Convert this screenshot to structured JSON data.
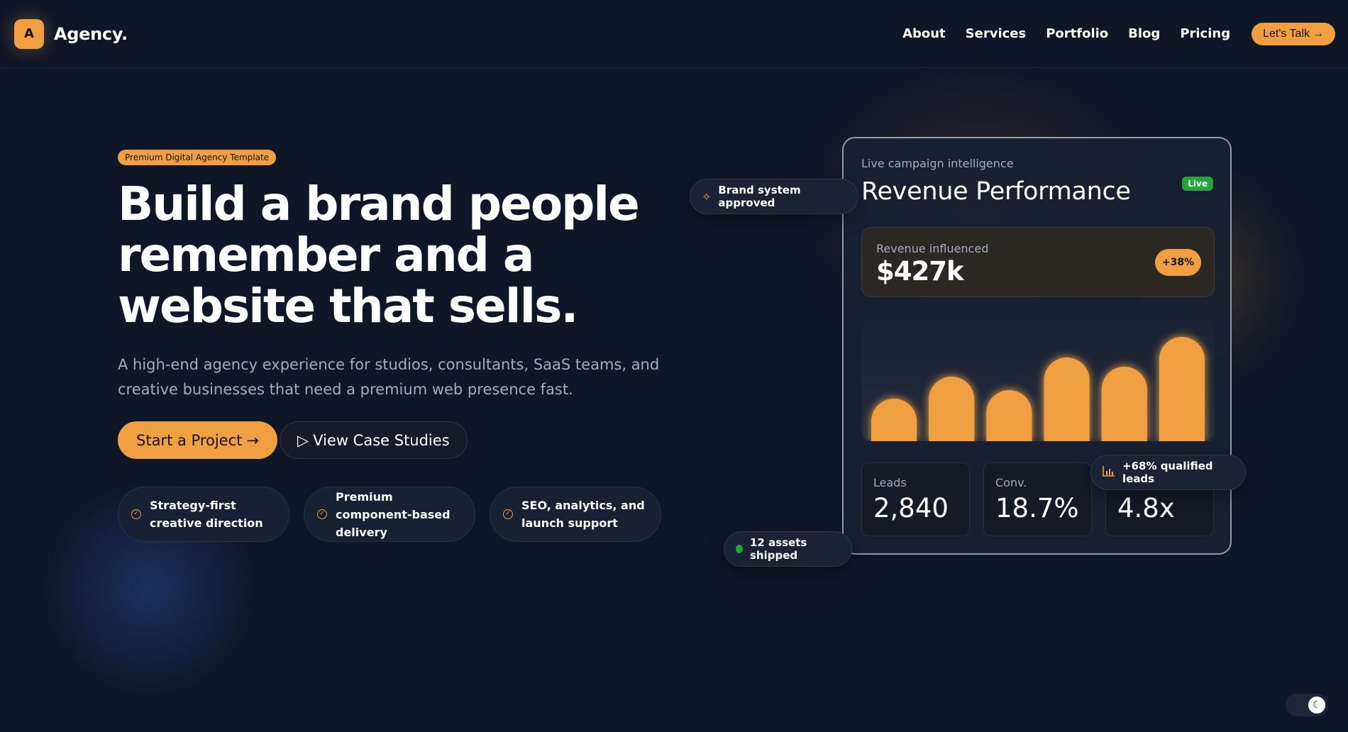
{
  "colors": {
    "accent": "#f0a040",
    "background": "#0f1628",
    "card": "#182133",
    "success": "#22a63c",
    "muted_text": "#a3adc2"
  },
  "header": {
    "logo_letter": "A",
    "brand_name": "Agency.",
    "nav": [
      {
        "label": "About"
      },
      {
        "label": "Services"
      },
      {
        "label": "Portfolio"
      },
      {
        "label": "Blog"
      },
      {
        "label": "Pricing"
      }
    ],
    "cta_label": "Let's Talk",
    "cta_icon": "arrow-right-icon"
  },
  "hero": {
    "badge": "Premium Digital Agency Template",
    "title_lines": [
      "Build a brand people",
      "remember and a",
      "website that sells."
    ],
    "subtitle": "A high-end agency experience for studios, consultants, SaaS teams, and creative businesses that need a premium web presence fast.",
    "primary_cta": "Start a Project",
    "secondary_cta": "View Case Studies",
    "features": [
      {
        "text": "Strategy-first creative direction",
        "icon": "check-circle-icon"
      },
      {
        "text": "Premium component-based delivery",
        "icon": "check-circle-icon"
      },
      {
        "text": "SEO, analytics, and launch support",
        "icon": "check-circle-icon"
      }
    ]
  },
  "dashboard": {
    "eyebrow": "Live campaign intelligence",
    "title": "Revenue Performance",
    "live_badge": "Live",
    "revenue_label": "Revenue influenced",
    "revenue_value": "$427k",
    "revenue_delta": "+38%",
    "stats": [
      {
        "label": "Leads",
        "value": "2,840"
      },
      {
        "label": "Conv.",
        "value": "18.7%"
      },
      {
        "label": "",
        "value": "4.8x"
      }
    ]
  },
  "chart_data": {
    "type": "bar",
    "values": [
      60,
      91,
      72,
      118,
      105,
      147
    ],
    "ylim": [
      0,
      160
    ],
    "color": "#f0a040"
  },
  "pills": {
    "brand_system": "Brand system approved",
    "qualified_leads": "+68% qualified leads",
    "assets_shipped": "12 assets shipped"
  },
  "theme_toggle": {
    "icon": "moon-icon"
  }
}
